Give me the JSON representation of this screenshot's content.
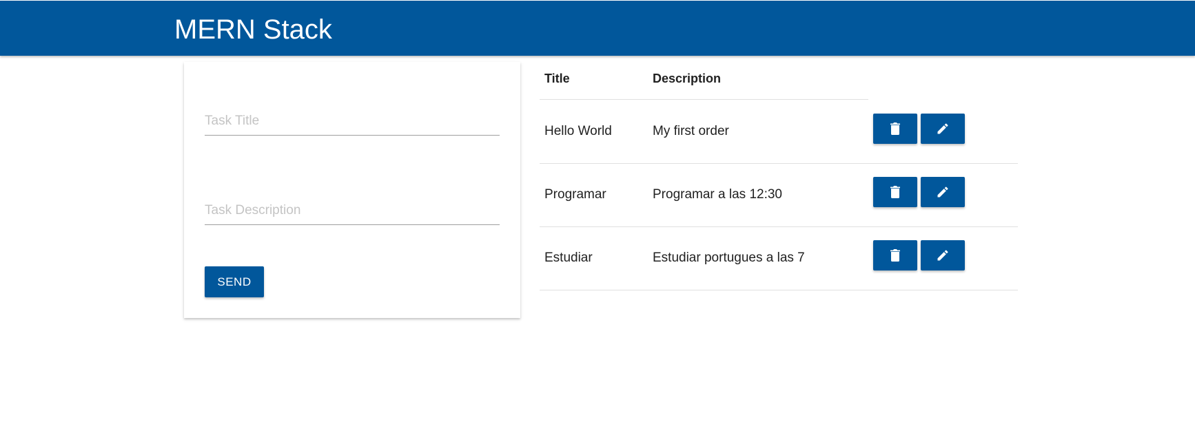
{
  "navbar": {
    "brand": "MERN Stack"
  },
  "form": {
    "title_placeholder": "Task Title",
    "description_placeholder": "Task Description",
    "send_label": "SEND"
  },
  "table": {
    "headers": {
      "title": "Title",
      "description": "Description"
    },
    "rows": [
      {
        "title": "Hello World",
        "description": "My first order"
      },
      {
        "title": "Programar",
        "description": "Programar a las 12:30"
      },
      {
        "title": "Estudiar",
        "description": "Estudiar portugues a las 7"
      }
    ]
  },
  "icons": {
    "delete": "trash-icon",
    "edit": "pencil-icon"
  },
  "colors": {
    "primary": "#01579b"
  }
}
